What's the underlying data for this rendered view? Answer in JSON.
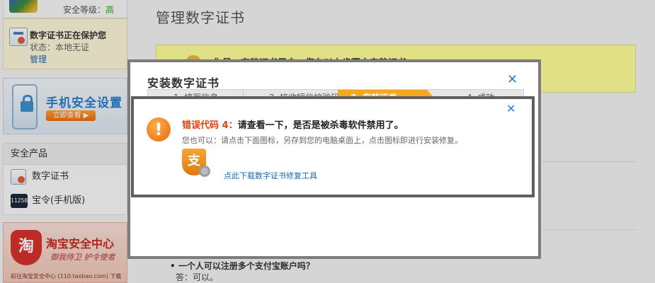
{
  "sidebar": {
    "security_level_label": "安全等级：",
    "security_level_value": "高",
    "protect_card": {
      "title": "数字证书正在保护您",
      "state": "状态：本地无证",
      "manage_link": "管理"
    },
    "mobile_banner": {
      "title": "手机安全设置",
      "button": "立即查看 ▶"
    },
    "products": {
      "heading": "安全产品",
      "items": [
        {
          "label": "数字证书",
          "icon": "certificate-icon"
        },
        {
          "label": "宝令(手机版)",
          "icon": "token-icon",
          "token_text": "11258"
        }
      ]
    },
    "taobao_banner": {
      "shield_char": "淘",
      "title": "淘宝安全中心",
      "slogan": "御我侍卫  护令使者",
      "link": "前往淘宝安全中心 (110.taobao.com) 下载"
    }
  },
  "main": {
    "page_title": "管理数字证书",
    "notice_text": "你是…安装证书用户，您在以上步骤中安装证书",
    "faq": {
      "question": "• 一个人可以注册多个支付宝账户吗？",
      "answer": "答：可以。"
    }
  },
  "install_dialog": {
    "title": "安装数字证书",
    "close_glyph": "✕",
    "steps": [
      {
        "label": "1. 填写信息",
        "state": "done"
      },
      {
        "label": "2. 接收短信校验码",
        "state": "done"
      },
      {
        "label": "3. 安装证书",
        "state": "active"
      },
      {
        "label": "4. 成功",
        "state": "pending"
      }
    ]
  },
  "error_dialog": {
    "close_glyph": "✕",
    "alert_glyph": "!",
    "error_code": "错误代码 4：",
    "headline": "请查看一下，是否是被杀毒软件禁用了。",
    "description": "您也可以：请点击下面图标，另存到您的电脑桌面上，点击图标即进行安装修复。",
    "tool_icon_char": "支",
    "repair_link": "点此下载数字证书修复工具"
  },
  "colors": {
    "link": "#1d67b3",
    "error_code": "#e3420b",
    "active_step": "#f4a81c",
    "notice_bg": "#ffff99"
  }
}
